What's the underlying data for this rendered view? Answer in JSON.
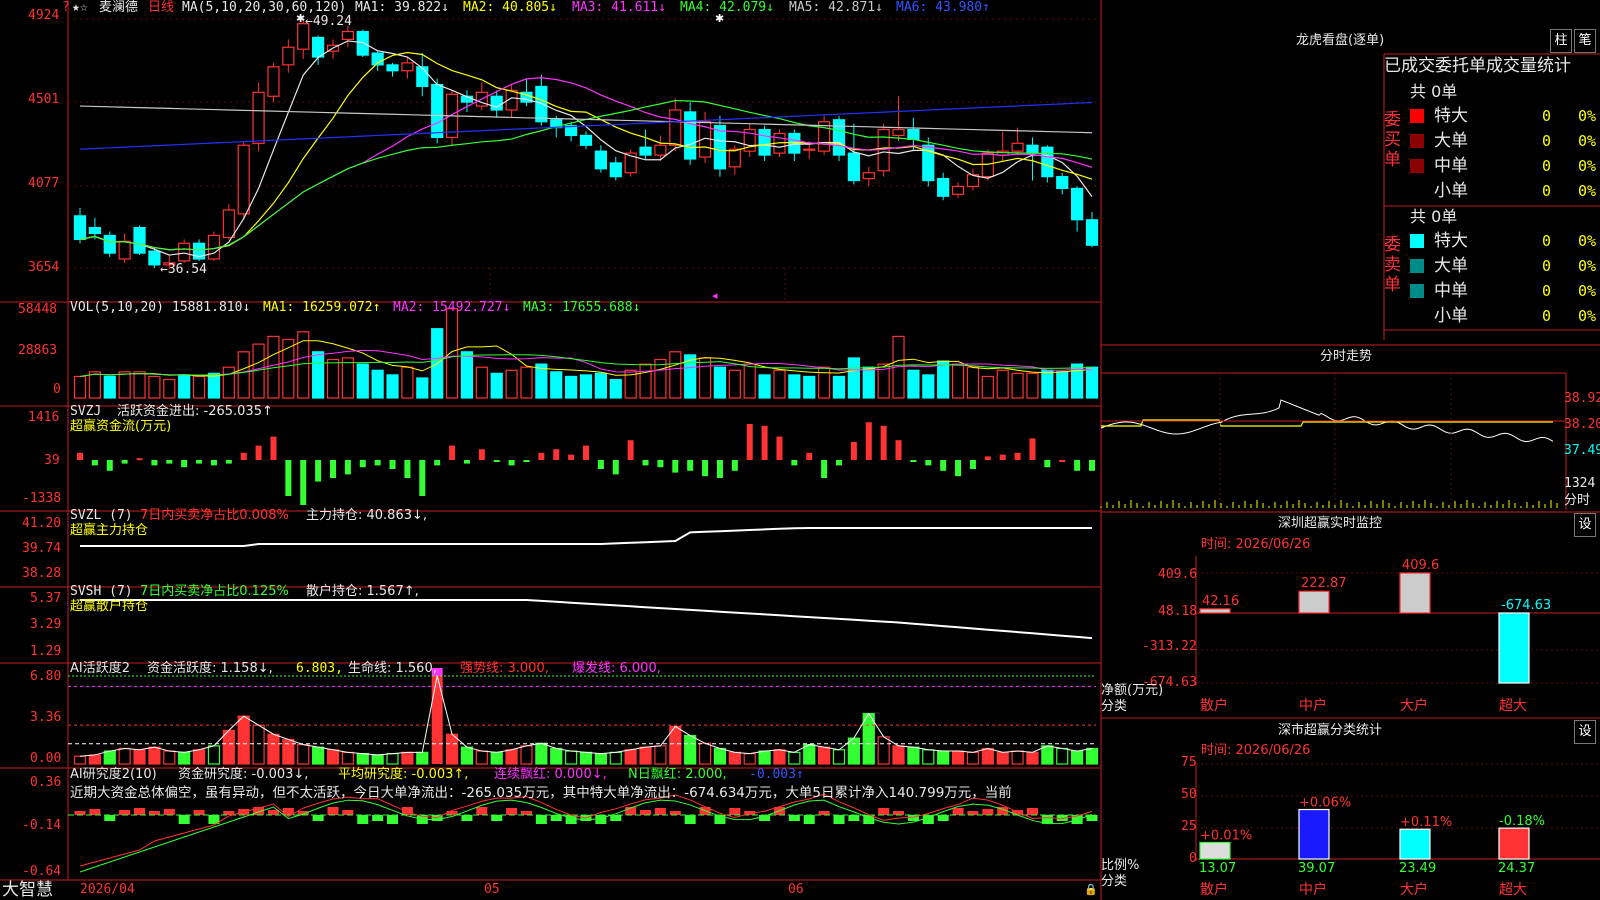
{
  "colors": {
    "up": "#ff3333",
    "down": "#00ffff",
    "grid": "#c81e1e",
    "bg": "#000000",
    "white": "#e8e8e8",
    "yellow": "#ffff00",
    "magenta": "#ff33ff",
    "green": "#33ff33",
    "blue": "#2233ff",
    "gray": "#c8c8c8"
  },
  "main": {
    "stock_name": "麦澜德",
    "period": "日线",
    "ma_params": "MA(5,10,20,30,60,120)",
    "ma1": "MA1: 39.822↓",
    "ma2": "MA2: 40.805↓",
    "ma3": "MA3: 41.611↓",
    "ma4": "MA4: 42.079↓",
    "ma5": "MA5: 42.871↓",
    "ma6": "MA6: 43.980↑",
    "yaxis": [
      "4924",
      "4501",
      "4077",
      "3654"
    ],
    "high_label": "49.24",
    "low_label": "36.54"
  },
  "vol": {
    "title": "VOL(5,10,20)",
    "value": "15881.810↓",
    "ma1": "MA1: 16259.072↑",
    "ma2": "MA2: 15492.727↓",
    "ma3": "MA3: 17655.688↓",
    "yaxis": [
      "58448",
      "28863",
      "0"
    ]
  },
  "svzj": {
    "title": "SVZJ",
    "text": "活跃资金进出: -265.035↑",
    "sub": "超赢资金流(万元)",
    "yaxis": [
      "1416",
      "39",
      "-1338"
    ]
  },
  "svzl": {
    "title": "SVZL (7)",
    "net": "7日内买卖净占比0.008%",
    "hold": "主力持仓: 40.863↓,",
    "sub": "超赢主力持仓",
    "yaxis": [
      "41.20",
      "39.74",
      "38.28"
    ]
  },
  "svsh": {
    "title": "SVSH (7)",
    "net": "7日内买卖净占比0.125%",
    "hold": "散户持仓: 1.567↑,",
    "sub": "超赢散户持仓",
    "yaxis": [
      "5.37",
      "3.29",
      "1.29"
    ]
  },
  "ai1": {
    "title": "AI活跃度2",
    "act": "资金活跃度: 1.158↓,",
    "v2": "6.803,",
    "life": "生命线: 1.560,",
    "strong": "强势线: 3.000,",
    "burst": "爆发线: 6.000,",
    "yaxis": [
      "6.80",
      "3.36",
      "0.00"
    ]
  },
  "ai2": {
    "title": "AI研究度2(10)",
    "res": "资金研究度: -0.003↓,",
    "avg": "平均研究度: -0.003↑,",
    "cont": "连续飘红: 0.000↓,",
    "nday": "N日飘红: 2.000,",
    "last": "-0.003↑",
    "text": "近期大资金总体偏空，虽有异动，但不太活跃，今日大单净流出：-265.035万元，其中特大单净流出：-674.634万元，大单5日累计净入140.799万元，当前",
    "yaxis": [
      "0.36",
      "-0.14",
      "-0.64"
    ]
  },
  "footer": {
    "brand": "大智慧",
    "date1": "2026/04",
    "m5": "05",
    "m6": "06"
  },
  "lhb": {
    "title": "龙虎看盘(逐单)",
    "btn1": "柱",
    "btn2": "笔",
    "header": "已成交委托单成交量统计",
    "buy_total": "共 0单",
    "sell_total": "共 0单",
    "buy_label": "委买单",
    "sell_label": "委卖单",
    "buy_rows": [
      {
        "name": "特大",
        "vol": "0",
        "pct": "0%"
      },
      {
        "name": "大单",
        "vol": "0",
        "pct": "0%"
      },
      {
        "name": "中单",
        "vol": "0",
        "pct": "0%"
      },
      {
        "name": "小单",
        "vol": "0",
        "pct": "0%"
      }
    ],
    "sell_rows": [
      {
        "name": "特大",
        "vol": "0",
        "pct": "0%"
      },
      {
        "name": "大单",
        "vol": "0",
        "pct": "0%"
      },
      {
        "name": "中单",
        "vol": "0",
        "pct": "0%"
      },
      {
        "name": "小单",
        "vol": "0",
        "pct": "0%"
      }
    ]
  },
  "intraday": {
    "title": "分时走势",
    "yaxis": [
      "38.92",
      "38.20",
      "37.49"
    ],
    "vol": "1324",
    "unit": "分时"
  },
  "monitor": {
    "title": "深圳超赢实时监控",
    "btn": "设",
    "time": "时间: 2026/06/26",
    "yaxis": [
      "409.6",
      "48.18",
      "-313.22",
      "-674.63"
    ],
    "ylabel": "净额(万元)",
    "xlabel": "分类",
    "cats": [
      "散户",
      "中户",
      "大户",
      "超大"
    ],
    "values": [
      42.16,
      222.87,
      409.6,
      -674.63
    ],
    "labels": [
      "42.16",
      "222.87",
      "409.6",
      "-674.63"
    ]
  },
  "stats": {
    "title": "深市超赢分类统计",
    "btn": "设",
    "time": "时间: 2026/06/26",
    "yaxis": [
      "75",
      "50",
      "25",
      "0"
    ],
    "ylabel": "比例%",
    "xlabel": "分类",
    "cats": [
      "散户",
      "中户",
      "大户",
      "超大"
    ],
    "values": [
      13.07,
      39.07,
      23.49,
      24.37
    ],
    "labels": [
      "13.07",
      "39.07",
      "23.49",
      "24.37"
    ],
    "changes": [
      "+0.01%",
      "+0.06%",
      "+0.11%",
      "-0.18%"
    ]
  },
  "chart_data": {
    "type": "candlestick",
    "candles": [
      [
        39.2,
        38.0,
        39.6,
        37.8
      ],
      [
        38.6,
        38.3,
        39.1,
        38.0
      ],
      [
        38.2,
        37.3,
        38.4,
        37.1
      ],
      [
        37.0,
        37.9,
        38.3,
        36.8
      ],
      [
        38.6,
        37.3,
        38.7,
        37.2
      ],
      [
        37.4,
        36.7,
        37.6,
        36.54
      ],
      [
        36.7,
        36.8,
        37.2,
        36.5
      ],
      [
        36.9,
        37.8,
        38.0,
        36.8
      ],
      [
        37.8,
        37.0,
        38.0,
        36.9
      ],
      [
        37.0,
        38.2,
        38.4,
        36.9
      ],
      [
        38.1,
        39.5,
        39.8,
        38.0
      ],
      [
        39.3,
        42.8,
        43.0,
        39.0
      ],
      [
        42.9,
        45.5,
        46.0,
        42.5
      ],
      [
        45.3,
        46.8,
        47.0,
        45.0
      ],
      [
        46.9,
        47.8,
        48.2,
        46.5
      ],
      [
        47.7,
        49.0,
        49.24,
        47.2
      ],
      [
        48.3,
        47.3,
        48.4,
        46.9
      ],
      [
        47.6,
        47.9,
        48.2,
        47.2
      ],
      [
        48.2,
        48.6,
        48.9,
        47.8
      ],
      [
        48.6,
        47.4,
        48.7,
        47.3
      ],
      [
        47.5,
        46.9,
        47.6,
        46.6
      ],
      [
        46.9,
        46.6,
        47.0,
        46.3
      ],
      [
        46.6,
        47.0,
        47.3,
        46.2
      ],
      [
        46.8,
        45.8,
        47.5,
        45.3
      ],
      [
        45.9,
        43.2,
        46.2,
        42.9
      ],
      [
        43.2,
        45.4,
        45.6,
        42.8
      ],
      [
        45.3,
        45.0,
        45.6,
        44.5
      ],
      [
        44.8,
        45.5,
        46.0,
        44.6
      ],
      [
        45.3,
        44.6,
        45.6,
        44.2
      ],
      [
        44.6,
        45.6,
        45.9,
        44.2
      ],
      [
        45.5,
        45.0,
        46.2,
        44.8
      ],
      [
        45.8,
        44.0,
        46.4,
        43.8
      ],
      [
        44.1,
        43.7,
        44.3,
        43.2
      ],
      [
        43.8,
        43.3,
        44.0,
        43.0
      ],
      [
        43.3,
        42.8,
        43.5,
        42.6
      ],
      [
        42.5,
        41.6,
        42.8,
        41.4
      ],
      [
        41.9,
        41.2,
        42.2,
        41.0
      ],
      [
        41.4,
        42.4,
        42.6,
        41.2
      ],
      [
        42.7,
        42.3,
        43.6,
        42.1
      ],
      [
        42.3,
        42.8,
        43.3,
        42.0
      ],
      [
        42.8,
        44.6,
        45.2,
        42.5
      ],
      [
        44.5,
        42.1,
        45.0,
        41.8
      ],
      [
        42.2,
        44.0,
        44.5,
        41.9
      ],
      [
        43.8,
        41.6,
        44.3,
        41.2
      ],
      [
        41.7,
        42.6,
        42.8,
        41.3
      ],
      [
        42.5,
        43.6,
        43.9,
        42.2
      ],
      [
        43.6,
        42.3,
        43.8,
        42.0
      ],
      [
        42.4,
        43.4,
        43.6,
        42.2
      ],
      [
        43.4,
        42.4,
        43.6,
        42.0
      ],
      [
        42.6,
        42.6,
        43.0,
        42.1
      ],
      [
        42.5,
        44.0,
        44.3,
        42.3
      ],
      [
        44.1,
        42.3,
        44.3,
        42.0
      ],
      [
        42.4,
        41.0,
        43.9,
        40.8
      ],
      [
        41.1,
        41.4,
        41.7,
        40.7
      ],
      [
        41.5,
        43.6,
        43.9,
        41.2
      ],
      [
        43.3,
        43.6,
        45.3,
        43.0
      ],
      [
        43.6,
        43.1,
        44.2,
        42.5
      ],
      [
        42.8,
        41.0,
        43.2,
        40.7
      ],
      [
        41.1,
        40.2,
        41.4,
        40.0
      ],
      [
        40.3,
        40.7,
        40.9,
        40.1
      ],
      [
        40.7,
        41.3,
        41.6,
        40.5
      ],
      [
        41.2,
        42.4,
        42.6,
        41.0
      ],
      [
        42.3,
        42.5,
        43.5,
        42.0
      ],
      [
        42.5,
        42.9,
        43.7,
        42.3
      ],
      [
        42.8,
        42.4,
        43.2,
        41.0
      ],
      [
        42.7,
        41.2,
        42.8,
        40.9
      ],
      [
        41.2,
        40.6,
        41.4,
        40.3
      ],
      [
        40.6,
        39.0,
        40.7,
        38.4
      ],
      [
        39.0,
        37.7,
        39.4,
        37.6
      ]
    ],
    "volume_dir": [
      1,
      1,
      0,
      1,
      1,
      1,
      1,
      0,
      1,
      0,
      1,
      1,
      1,
      1,
      1,
      1,
      0,
      1,
      1,
      0,
      0,
      0,
      1,
      0,
      0,
      1,
      0,
      1,
      0,
      1,
      1,
      0,
      0,
      0,
      0,
      0,
      0,
      1,
      1,
      1,
      1,
      0,
      1,
      0,
      1,
      1,
      0,
      1,
      0,
      0,
      1,
      0,
      0,
      0,
      1,
      1,
      0,
      0,
      0,
      1,
      1,
      1,
      1,
      1,
      1,
      0,
      0,
      0,
      0
    ],
    "volume": [
      14,
      17,
      14,
      17,
      17,
      14,
      12,
      15,
      14,
      16,
      20,
      30,
      35,
      40,
      38,
      43,
      30,
      25,
      26,
      22,
      18,
      15,
      20,
      13,
      45,
      58,
      30,
      20,
      16,
      18,
      20,
      22,
      17,
      14,
      15,
      16,
      12,
      18,
      22,
      25,
      30,
      28,
      26,
      20,
      18,
      22,
      15,
      18,
      15,
      14,
      20,
      14,
      26,
      20,
      22,
      40,
      18,
      15,
      24,
      22,
      20,
      14,
      18,
      16,
      16,
      18,
      17,
      22,
      20
    ]
  }
}
